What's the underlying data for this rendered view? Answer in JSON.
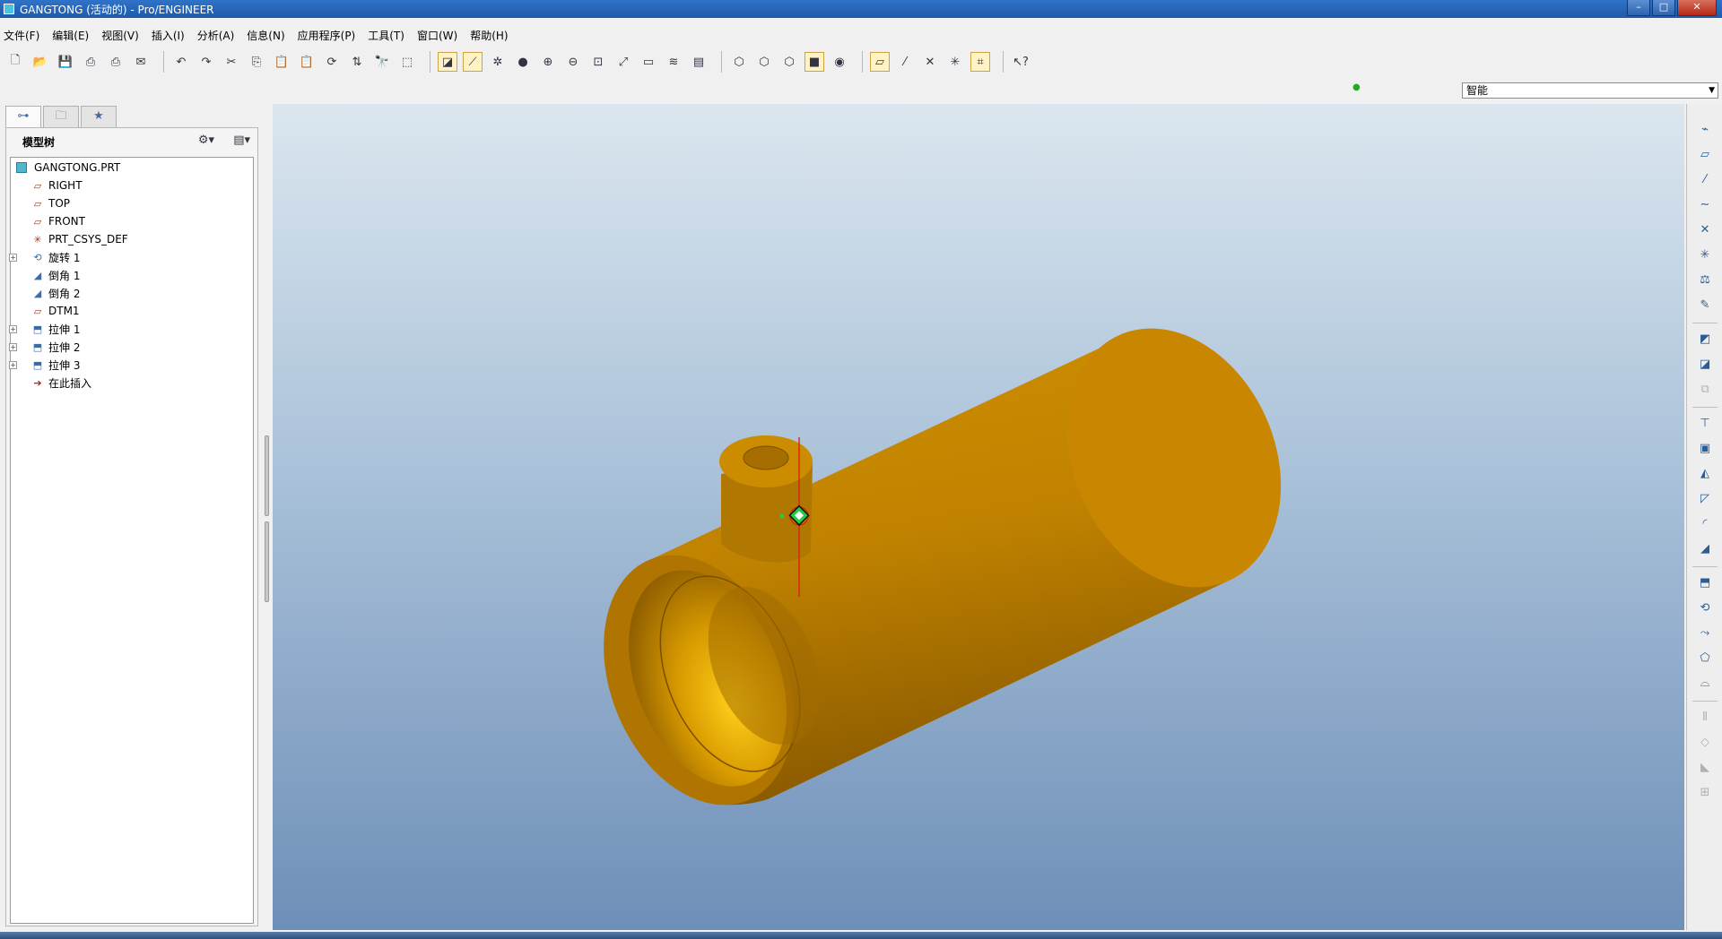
{
  "window": {
    "title": "GANGTONG (活动的) - Pro/ENGINEER",
    "minimize_icon": "minimize-icon",
    "maximize_icon": "maximize-icon",
    "close_icon": "close-icon"
  },
  "menu": {
    "items": [
      "文件(F)",
      "编辑(E)",
      "视图(V)",
      "插入(I)",
      "分析(A)",
      "信息(N)",
      "应用程序(P)",
      "工具(T)",
      "窗口(W)",
      "帮助(H)"
    ]
  },
  "filter": {
    "selected": "智能"
  },
  "navigator": {
    "tabs": [
      "model-tree-tab-icon",
      "folder-browser-tab-icon",
      "favorites-tab-icon"
    ],
    "header": "模型树"
  },
  "tree": {
    "root": "GANGTONG.PRT",
    "items": [
      {
        "label": "RIGHT",
        "icon": "datum-plane-icon"
      },
      {
        "label": "TOP",
        "icon": "datum-plane-icon"
      },
      {
        "label": "FRONT",
        "icon": "datum-plane-icon"
      },
      {
        "label": "PRT_CSYS_DEF",
        "icon": "csys-icon"
      },
      {
        "label": "旋转 1",
        "icon": "revolve-icon"
      },
      {
        "label": "倒角 1",
        "icon": "chamfer-icon"
      },
      {
        "label": "倒角 2",
        "icon": "chamfer-icon"
      },
      {
        "label": "DTM1",
        "icon": "datum-plane-icon"
      },
      {
        "label": "拉伸 1",
        "icon": "extrude-icon"
      },
      {
        "label": "拉伸 2",
        "icon": "extrude-icon"
      },
      {
        "label": "拉伸 3",
        "icon": "extrude-icon"
      },
      {
        "label": "在此插入",
        "icon": "insert-here-icon"
      }
    ]
  },
  "model": {
    "color": "#c98a00",
    "name": "GANGTONG"
  },
  "colors": {
    "title_bar": "#2f73c8",
    "viewport_top": "#dbe6ef",
    "viewport_bottom": "#6e8fb8",
    "model": "#c98a00"
  }
}
